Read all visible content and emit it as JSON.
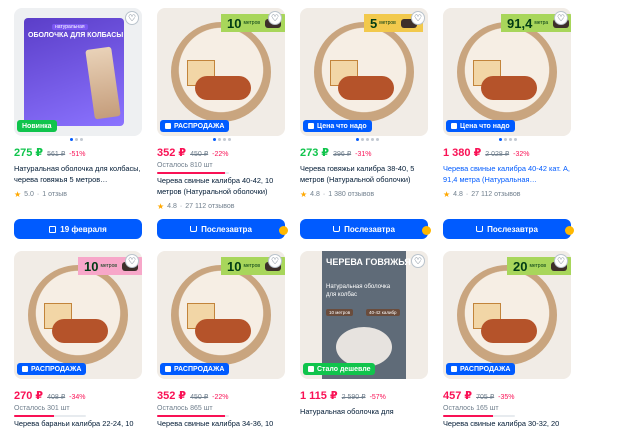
{
  "colors": {
    "accent_blue": "#005bff",
    "price_green": "#10c44c",
    "price_red": "#f91155",
    "muted": "#707f8d",
    "star": "#ffa800"
  },
  "products": [
    {
      "badge": "Новинка",
      "badge_style": "green",
      "image": {
        "kind": "box",
        "title": "ОБОЛОЧКА ДЛЯ КОЛБАСЫ",
        "tag": "натуральная"
      },
      "price": "275 ₽",
      "price_style": "green",
      "old_price": "561 ₽",
      "discount": "-51%",
      "title": "Натуральная оболочка для колбасы, черева говяжья 5 метров…",
      "rating": "5.0",
      "reviews": "1 отзыв",
      "button": "19 февраля",
      "button_icon": "calendar-icon",
      "dots": 3,
      "dot_active": 0
    },
    {
      "badge": "РАСПРОДАЖА",
      "badge_style": "blue",
      "image": {
        "kind": "tub",
        "tag_number": "10",
        "tag_unit": "метров",
        "tag_color": "lime",
        "animal": "pig-icon"
      },
      "price": "352 ₽",
      "price_style": "red",
      "old_price": "450 ₽",
      "discount": "-22%",
      "stock": "Осталось 810 шт",
      "stock_level": 0.95,
      "title": "Черева свиные калибра 40-42, 10 метров (Натуральной оболочки)",
      "rating": "4.8",
      "reviews": "27 112 отзывов",
      "button": "Послезавтра",
      "button_icon": "cart-icon",
      "dots": 4,
      "dot_active": 0
    },
    {
      "badge": "Цена что надо",
      "badge_style": "blue",
      "image": {
        "kind": "tub",
        "tag_number": "5",
        "tag_unit": "метров",
        "tag_color": "yellow",
        "animal": "cow-icon"
      },
      "price": "273 ₽",
      "price_style": "green",
      "old_price": "396 ₽",
      "discount": "-31%",
      "title": "Черева говяжьи калибра 38-40, 5 метров (Натуральной оболочки)",
      "rating": "4.8",
      "reviews": "1 380 отзывов",
      "button": "Послезавтра",
      "button_icon": "cart-icon",
      "dots": 5,
      "dot_active": 0
    },
    {
      "badge": "Цена что надо",
      "badge_style": "blue",
      "image": {
        "kind": "tub",
        "tag_number": "91,4",
        "tag_unit": "метра",
        "tag_color": "lime",
        "animal": "pig-icon"
      },
      "price": "1 380 ₽",
      "price_style": "red",
      "old_price": "2 028 ₽",
      "discount": "-32%",
      "title": "Черева свиные калибра 40-42 кат. А, 91,4 метра (Натуральная…",
      "title_style": "blue",
      "rating": "4.8",
      "reviews": "27 112 отзывов",
      "button": "Послезавтра",
      "button_icon": "cart-icon",
      "dots": 4,
      "dot_active": 0
    },
    {
      "badge": "РАСПРОДАЖА",
      "badge_style": "blue",
      "image": {
        "kind": "tub",
        "tag_number": "10",
        "tag_unit": "метров",
        "tag_color": "pink",
        "animal": "sheep-icon"
      },
      "price": "270 ₽",
      "price_style": "red",
      "old_price": "408 ₽",
      "discount": "-34%",
      "stock": "Осталось 301 шт",
      "stock_level": 0.55,
      "title": "Черева бараньи калибра 22-24, 10"
    },
    {
      "badge": "РАСПРОДАЖА",
      "badge_style": "blue",
      "image": {
        "kind": "tub",
        "tag_number": "10",
        "tag_unit": "метров",
        "tag_color": "lime",
        "animal": "pig-icon"
      },
      "price": "352 ₽",
      "price_style": "red",
      "old_price": "450 ₽",
      "discount": "-22%",
      "stock": "Осталось 865 шт",
      "stock_level": 0.95,
      "title": "Черева свиные калибра 34-36, 10"
    },
    {
      "badge": "Стало дешевле",
      "badge_style": "green",
      "image": {
        "kind": "poster",
        "title": "ЧЕРЕВА ГОВЯЖЬЯ",
        "subtitle": "Натуральная оболочка для колбас",
        "chip1": "10 метров",
        "chip2": "40-42 калибр"
      },
      "price": "1 115 ₽",
      "price_style": "red",
      "old_price": "2 590 ₽",
      "discount": "-57%",
      "title": "Натуральная оболочка для"
    },
    {
      "badge": "РАСПРОДАЖА",
      "badge_style": "blue",
      "image": {
        "kind": "tub",
        "tag_number": "20",
        "tag_unit": "метров",
        "tag_color": "lime",
        "animal": "pig-icon"
      },
      "price": "457 ₽",
      "price_style": "red",
      "old_price": "705 ₽",
      "discount": "-35%",
      "stock": "Осталось 165 шт",
      "stock_level": 0.7,
      "title": "Черева свиные калибра 30-32, 20"
    }
  ]
}
